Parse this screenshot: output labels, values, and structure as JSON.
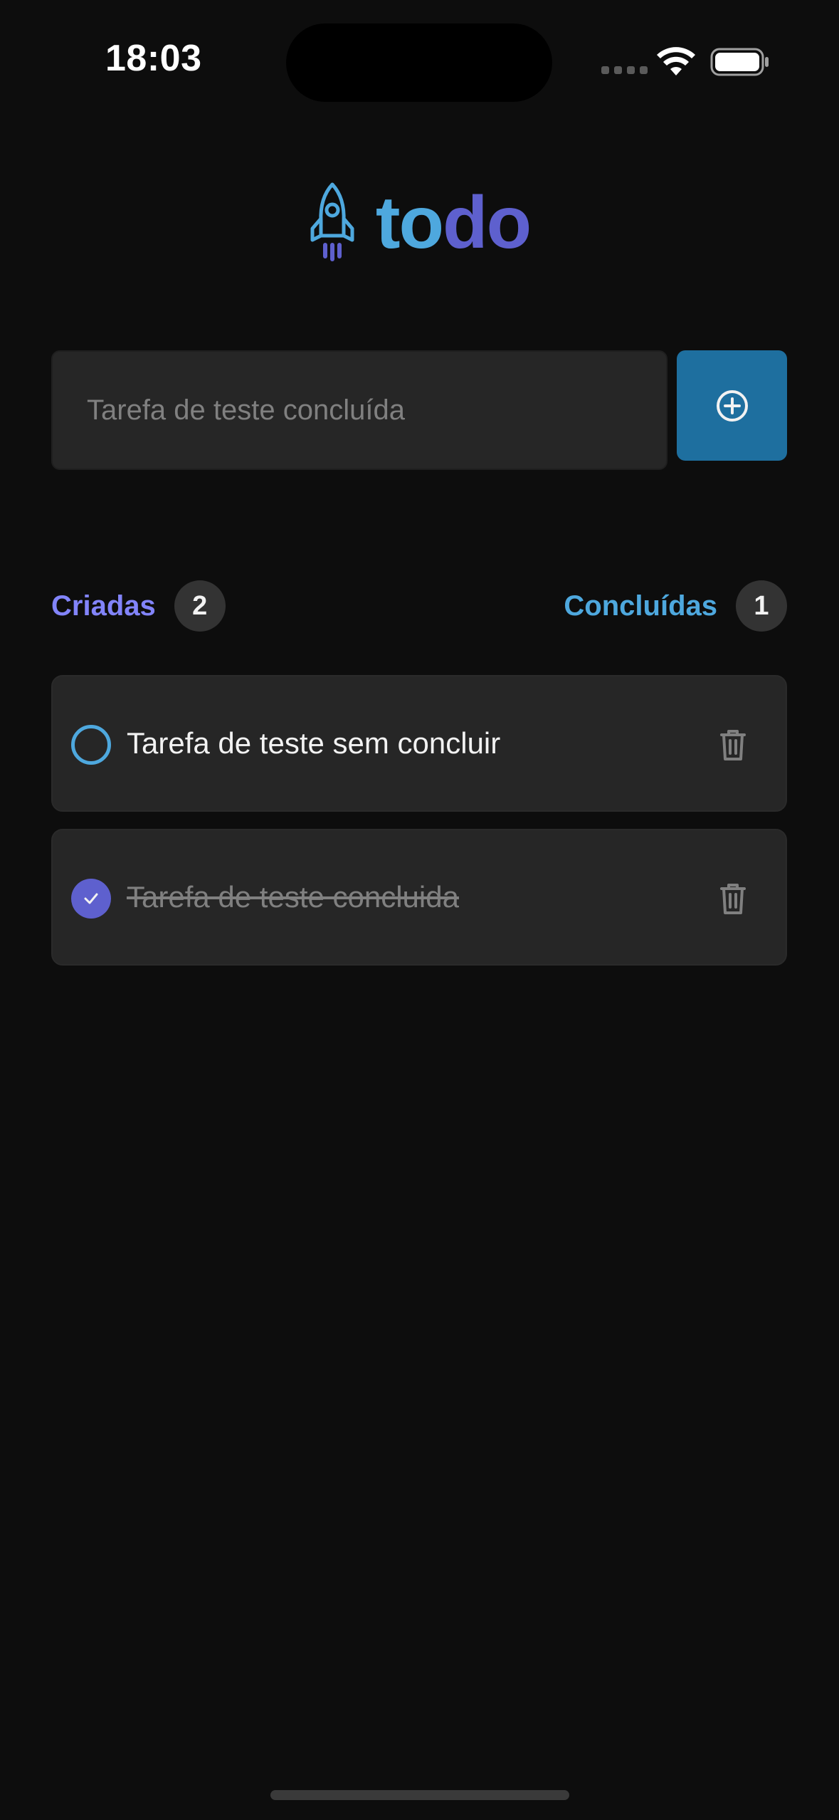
{
  "status_bar": {
    "time": "18:03",
    "wifi_icon": "wifi-icon",
    "battery_icon": "battery-icon"
  },
  "logo": {
    "icon": "rocket-icon",
    "text_part1": "to",
    "text_part2": "do",
    "colors": {
      "part1": "#4ea8de",
      "part2": "#5e60ce"
    }
  },
  "new_task": {
    "value": "Tarefa de teste concluída",
    "add_button_icon": "plus-circle-icon"
  },
  "counters": {
    "created_label": "Criadas",
    "created_count": "2",
    "done_label": "Concluídas",
    "done_count": "1"
  },
  "tasks": [
    {
      "text": "Tarefa de teste sem concluir",
      "completed": false
    },
    {
      "text": "Tarefa de teste concluida",
      "completed": true
    }
  ],
  "colors": {
    "background": "#0d0d0d",
    "surface": "#262626",
    "blue": "#4ea8de",
    "blue_dark": "#1e6f9f",
    "purple": "#5e60ce",
    "purple_light": "#8284fa"
  }
}
